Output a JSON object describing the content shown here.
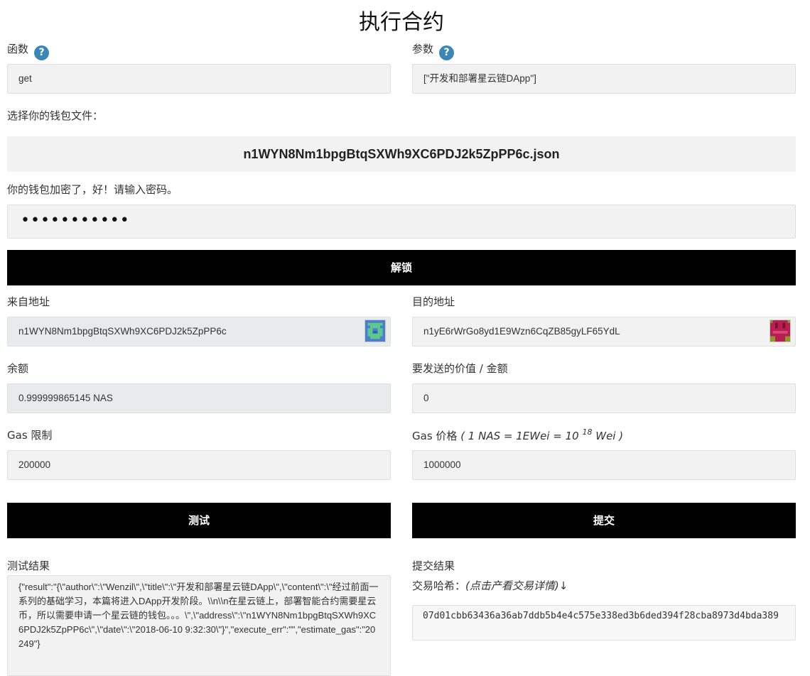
{
  "title": "执行合约",
  "function": {
    "label": "函数",
    "help_icon": "?",
    "value": "get"
  },
  "params": {
    "label": "参数",
    "help_icon": "?",
    "value": "[\"开发和部署星云链DApp\"]"
  },
  "wallet_file": {
    "label": "选择你的钱包文件：",
    "filename": "n1WYN8Nm1bpgBtqSXWh9XC6PDJ2k5ZpPP6c.json"
  },
  "password": {
    "label": "你的钱包加密了，好！请输入密码。",
    "mask": "•••••••••••"
  },
  "unlock_label": "解锁",
  "from_address": {
    "label": "来自地址",
    "value": "n1WYN8Nm1bpgBtqSXWh9XC6PDJ2k5ZpPP6c"
  },
  "to_address": {
    "label": "目的地址",
    "value": "n1yE6rWrGo8yd1E9Wzn6CqZB85gyLF65YdL"
  },
  "balance": {
    "label": "余额",
    "value": "0.999999865145 NAS"
  },
  "value_amount": {
    "label": "要发送的价值 / 金额",
    "value": "0"
  },
  "gas_limit": {
    "label": "Gas 限制",
    "value": "200000"
  },
  "gas_price": {
    "label": "Gas 价格",
    "note_pre": "( 1 NAS = 1EWei = 10",
    "note_exp": "18",
    "note_post": "Wei )",
    "value": "1000000"
  },
  "test_label": "测试",
  "submit_label": "提交",
  "test_result": {
    "label": "测试结果",
    "value": "{\"result\":\"{\\\"author\\\":\\\"Wenzil\\\",\\\"title\\\":\\\"开发和部署星云链DApp\\\",\\\"content\\\":\\\"经过前面一系列的基础学习，本篇将进入DApp开发阶段。\\\\n\\\\n在星云链上，部署智能合约需要星云币，所以需要申请一个星云链的钱包。。。\\\",\\\"address\\\":\\\"n1WYN8Nm1bpgBtqSXWh9XC6PDJ2k5ZpPP6c\\\",\\\"date\\\":\\\"2018-06-10 9:32:30\\\"}\",\"execute_err\":\"\",\"estimate_gas\":\"20249\"}"
  },
  "submit_result": {
    "label": "提交结果",
    "hash_label": "交易哈希：",
    "hash_link": "(点击产看交易详情)↓",
    "hash_value": "07d01cbb63436a36ab7ddb5b4e4c575e338ed3b6ded394f28cba8973d4bda389"
  },
  "colors": {
    "help_icon": "#3a87b5",
    "button_bg": "#000000",
    "field_bg": "#f2f2f2",
    "readonly_bg": "#e8ebee"
  }
}
